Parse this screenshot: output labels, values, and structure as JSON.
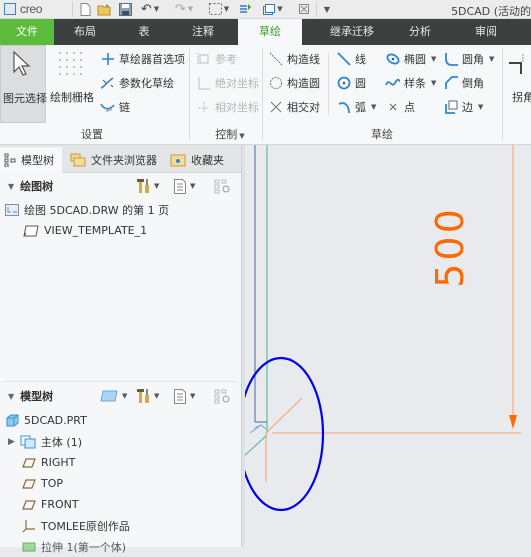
{
  "titlebar": {
    "app_logo": "creo",
    "window_title": "5DCAD (活动的",
    "quick_access": [
      "new-icon",
      "open-icon",
      "save-icon",
      "undo-icon",
      "redo-icon",
      "select-box-icon",
      "regenerate-icon",
      "windows-icon",
      "close-windows-icon",
      "customize-icon"
    ]
  },
  "tabs": [
    {
      "label": "文件",
      "state": "file"
    },
    {
      "label": "布局"
    },
    {
      "label": "表"
    },
    {
      "label": "注释"
    },
    {
      "label": "草绘",
      "state": "active"
    },
    {
      "label": "继承迁移"
    },
    {
      "label": "分析"
    },
    {
      "label": "审阅"
    }
  ],
  "ribbon": {
    "groups": {
      "settings": {
        "label": "设置",
        "select_button": "图元选择",
        "grid_button": "绘制栅格",
        "items": [
          "草绘器首选项",
          "参数化草绘",
          "链"
        ]
      },
      "control": {
        "label": "控制",
        "items": [
          "参考",
          "绝对坐标",
          "相对坐标"
        ]
      },
      "sketch": {
        "label": "草绘",
        "col1": [
          "构造线",
          "构造圆",
          "相交对"
        ],
        "col2": [
          "线",
          "圆",
          "弧"
        ],
        "col3": [
          "椭圆",
          "样条",
          "点"
        ],
        "col4": [
          "圆角",
          "倒角",
          "边"
        ]
      },
      "partial": {
        "label": "拐角"
      }
    }
  },
  "navtabs": [
    {
      "label": "模型树",
      "icon": "model-tree-icon"
    },
    {
      "label": "文件夹浏览器",
      "icon": "folder-browser-icon"
    },
    {
      "label": "收藏夹",
      "icon": "favorites-icon"
    }
  ],
  "drawing_tree": {
    "title": "绘图树",
    "items": [
      {
        "label": "绘图 5DCAD.DRW 的第 1 页",
        "icon": "drawing-sheet-icon"
      },
      {
        "label": "VIEW_TEMPLATE_1",
        "icon": "view-template-icon"
      }
    ]
  },
  "model_tree": {
    "title": "模型树",
    "items": [
      {
        "label": "5DCAD.PRT",
        "icon": "part-icon"
      },
      {
        "label": "主体 (1)",
        "icon": "body-icon",
        "expandable": true
      },
      {
        "label": "RIGHT",
        "icon": "datum-plane-icon"
      },
      {
        "label": "TOP",
        "icon": "datum-plane-icon"
      },
      {
        "label": "FRONT",
        "icon": "datum-plane-icon"
      },
      {
        "label": "TOMLEE原创作品",
        "icon": "coordinate-system-icon"
      },
      {
        "label": "拉伸 1(第一个体)",
        "icon": "extrude-icon"
      }
    ]
  },
  "canvas": {
    "dimension_value": "500",
    "colors": {
      "dimension": "#ff6a00",
      "highlight_ellipse": "#0000ee",
      "edge_blue": "#3a6db0",
      "edge_green": "#4db38a",
      "background": "#e8eaee"
    }
  },
  "colors": {
    "file_tab": "#5dbb3b",
    "tab_bar": "#3c4140",
    "active_tab_text": "#3a9b2a",
    "ribbon_bg": "#f7f8f9"
  }
}
